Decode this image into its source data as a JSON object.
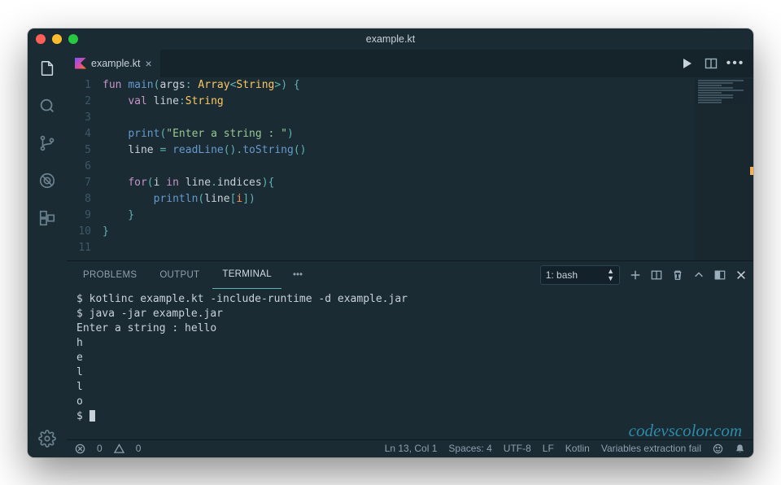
{
  "window": {
    "title": "example.kt"
  },
  "tab": {
    "filename": "example.kt"
  },
  "code": {
    "lines": [
      [
        {
          "text": "fun ",
          "cls": "kw"
        },
        {
          "text": "main",
          "cls": "fn"
        },
        {
          "text": "(",
          "cls": "punc"
        },
        {
          "text": "args",
          "cls": "id"
        },
        {
          "text": ": ",
          "cls": "punc"
        },
        {
          "text": "Array",
          "cls": "type"
        },
        {
          "text": "<",
          "cls": "punc"
        },
        {
          "text": "String",
          "cls": "type"
        },
        {
          "text": ">",
          "cls": "punc"
        },
        {
          "text": ") {",
          "cls": "punc"
        }
      ],
      [
        {
          "text": "    ",
          "cls": ""
        },
        {
          "text": "val ",
          "cls": "kw"
        },
        {
          "text": "line",
          "cls": "id"
        },
        {
          "text": ":",
          "cls": "punc"
        },
        {
          "text": "String",
          "cls": "type"
        }
      ],
      [],
      [
        {
          "text": "    ",
          "cls": ""
        },
        {
          "text": "print",
          "cls": "fn"
        },
        {
          "text": "(",
          "cls": "punc"
        },
        {
          "text": "\"Enter a string : \"",
          "cls": "str"
        },
        {
          "text": ")",
          "cls": "punc"
        }
      ],
      [
        {
          "text": "    ",
          "cls": ""
        },
        {
          "text": "line ",
          "cls": "id"
        },
        {
          "text": "= ",
          "cls": "punc"
        },
        {
          "text": "readLine",
          "cls": "fn"
        },
        {
          "text": "().",
          "cls": "punc"
        },
        {
          "text": "toString",
          "cls": "fn"
        },
        {
          "text": "()",
          "cls": "punc"
        }
      ],
      [],
      [
        {
          "text": "    ",
          "cls": ""
        },
        {
          "text": "for",
          "cls": "kw"
        },
        {
          "text": "(",
          "cls": "punc"
        },
        {
          "text": "i ",
          "cls": "id"
        },
        {
          "text": "in ",
          "cls": "in"
        },
        {
          "text": "line",
          "cls": "id"
        },
        {
          "text": ".",
          "cls": "punc"
        },
        {
          "text": "indices",
          "cls": "prop"
        },
        {
          "text": "){",
          "cls": "punc"
        }
      ],
      [
        {
          "text": "        ",
          "cls": ""
        },
        {
          "text": "println",
          "cls": "fn"
        },
        {
          "text": "(",
          "cls": "punc"
        },
        {
          "text": "line",
          "cls": "id"
        },
        {
          "text": "[",
          "cls": "punc"
        },
        {
          "text": "i",
          "cls": "idx"
        },
        {
          "text": "])",
          "cls": "punc"
        }
      ],
      [
        {
          "text": "    }",
          "cls": "punc"
        }
      ],
      [
        {
          "text": "}",
          "cls": "punc"
        }
      ],
      []
    ],
    "line_count": 11
  },
  "panel": {
    "tabs": {
      "problems": "PROBLEMS",
      "output": "OUTPUT",
      "terminal": "TERMINAL"
    },
    "terminal_picker": "1: bash"
  },
  "terminal": {
    "lines": [
      "$ kotlinc example.kt -include-runtime -d example.jar",
      "$ java -jar example.jar",
      "Enter a string : hello",
      "h",
      "e",
      "l",
      "l",
      "o",
      "$ "
    ]
  },
  "watermark": "codevscolor.com",
  "status": {
    "errors": "0",
    "warnings": "0",
    "position": "Ln 13, Col 1",
    "spaces": "Spaces: 4",
    "encoding": "UTF-8",
    "eol": "LF",
    "language": "Kotlin",
    "ext": "Variables extraction fail"
  }
}
